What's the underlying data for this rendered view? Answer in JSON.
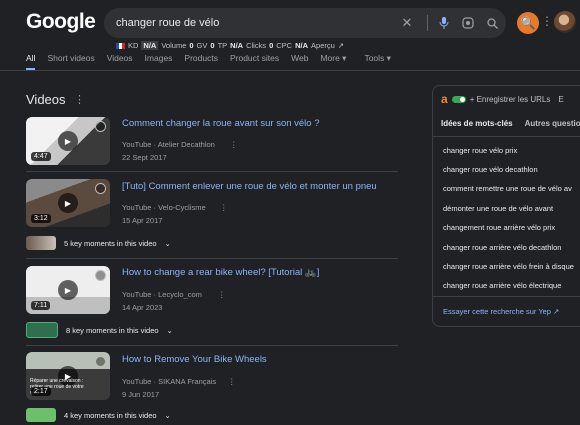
{
  "logo": "Google",
  "search": {
    "query": "changer roue de vélo"
  },
  "seo_bar": {
    "kd_label": "KD",
    "kd_value": "N/A",
    "volume_label": "Volume",
    "volume_value": "0",
    "gv_label": "GV",
    "gv_value": "0",
    "tp_label": "TP",
    "tp_value": "N/A",
    "clicks_label": "Clicks",
    "clicks_value": "0",
    "cpc_label": "CPC",
    "cpc_value": "N/A",
    "preview_label": "Aperçu"
  },
  "tabs": [
    "All",
    "Short videos",
    "Videos",
    "Images",
    "Products",
    "Product sites",
    "Web",
    "More ▾",
    "Tools ▾"
  ],
  "videos_section": {
    "title": "Videos"
  },
  "videos": [
    {
      "title": "Comment changer la roue avant sur son vélo ?",
      "source": "YouTube · Atelier Decathlon",
      "date": "22 Sept 2017",
      "duration": "4:47",
      "key_moments": ""
    },
    {
      "title": "[Tuto] Comment enlever une roue de vélo et monter un pneu",
      "source": "YouTube · Velo-Cyclisme",
      "date": "15 Apr 2017",
      "duration": "3:12",
      "key_moments": "5 key moments in this video"
    },
    {
      "title": "How to change a rear bike wheel? [Tutorial 🚲]",
      "source": "YouTube · Lecyclo_com",
      "date": "14 Apr 2023",
      "duration": "7:11",
      "key_moments": "8 key moments in this video"
    },
    {
      "title": "How to Remove Your Bike Wheels",
      "source": "YouTube · SIKANA Français",
      "date": "9 Jun 2017",
      "duration": "2:17",
      "key_moments": "4 key moments in this video",
      "thumb_caption": "Réparer une crevaison : retirer une roue de votre vélo"
    }
  ],
  "panel": {
    "logo": "a",
    "save_urls": "+ Enregistrer les URLs",
    "extra": "E",
    "tab_keywords": "Idées de mots-clés",
    "tab_questions": "Autres questions",
    "keywords": [
      "changer roue vélo prix",
      "changer roue vélo decathlon",
      "comment remettre une roue de vélo av",
      "démonter une roue de vélo avant",
      "changement roue arrière vélo prix",
      "changer roue arrière vélo decathlon",
      "changer roue arrière vélo frein à disque",
      "changer roue arrière vélo électrique"
    ],
    "yep": "Essayer cette recherche sur Yep ↗"
  },
  "colors": {
    "accent": "#8ab4f8",
    "bg": "#202124",
    "ext": "#e8782a"
  }
}
